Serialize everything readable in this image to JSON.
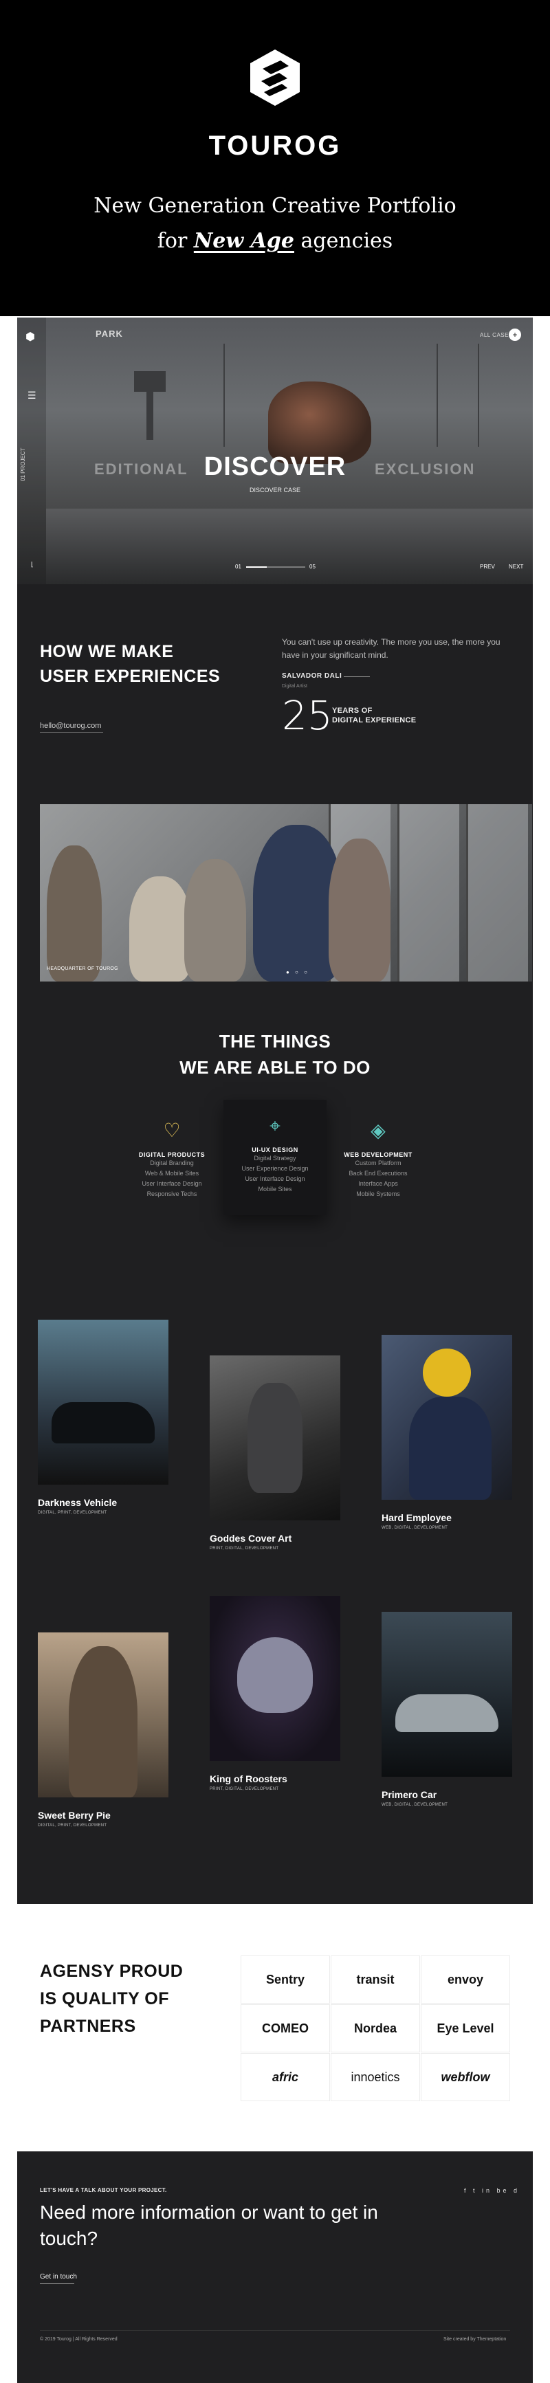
{
  "hero": {
    "brand": "TOUROG",
    "tagline_line1": "New Generation Creative Portfolio",
    "tagline_pre": "for ",
    "tagline_em": "New Age",
    "tagline_post": " agencies"
  },
  "mockup_header": {
    "logo_label": "PARK",
    "all_cases": "ALL CASES",
    "plus": "+",
    "side_label": "01 PROJECT",
    "slide_left": "EDITIONAL",
    "slide_title": "DISCOVER",
    "slide_subtitle": "DISCOVER CASE",
    "slide_right": "EXCLUSION",
    "pager_start": "01",
    "pager_end": "05",
    "pager_progress": 0.35,
    "prev": "PREV",
    "next": "NEXT"
  },
  "intro": {
    "heading_line1": "HOW WE MAKE",
    "heading_line2": "USER EXPERIENCES",
    "email": "hello@tourog.com",
    "quote": "You can't use up creativity. The more you use, the more you have in your significant mind.",
    "author": "SALVADOR DALI",
    "author_role": "Digital Artist",
    "years": "25",
    "years_label_line1": "YEARS OF",
    "years_label_line2": "DIGITAL EXPERIENCE"
  },
  "team": {
    "caption": "HEADQUARTER OF TOUROG"
  },
  "services": {
    "title_line1": "THE THINGS",
    "title_line2": "WE ARE ABLE TO DO",
    "items": [
      {
        "icon": "lightbulb-icon",
        "name": "DIGITAL PRODUCTS",
        "lines": [
          "Digital Branding",
          "Web & Mobile Sites",
          "User Interface Design",
          "Responsive Techs"
        ]
      },
      {
        "icon": "vector-pen-icon",
        "name": "UI-UX DESIGN",
        "lines": [
          "Digital Strategy",
          "User Experience Design",
          "User Interface Design",
          "Mobile Sites"
        ]
      },
      {
        "icon": "layers-icon",
        "name": "WEB DEVELOPMENT",
        "lines": [
          "Custom Platform",
          "Back End Executions",
          "Interface Apps",
          "Mobile Systems"
        ]
      }
    ]
  },
  "portfolio": [
    {
      "title": "Darkness Vehicle",
      "meta": "DIGITAL, PRINT, DEVELOPMENT"
    },
    {
      "title": "Goddes Cover Art",
      "meta": "PRINT, DIGITAL, DEVELOPMENT"
    },
    {
      "title": "Hard Employee",
      "meta": "WEB, DIGITAL, DEVELOPMENT"
    },
    {
      "title": "Sweet Berry Pie",
      "meta": "DIGITAL, PRINT, DEVELOPMENT"
    },
    {
      "title": "King of Roosters",
      "meta": "PRINT, DIGITAL, DEVELOPMENT"
    },
    {
      "title": "Primero Car",
      "meta": "WEB, DIGITAL, DEVELOPMENT"
    }
  ],
  "partners": {
    "heading_line1": "AGENSY PROUD",
    "heading_line2": "IS QUALITY OF",
    "heading_line3": "PARTNERS",
    "logos": [
      "Sentry",
      "transit",
      "envoy",
      "COMEO",
      "Nordea",
      "Eye Level",
      "afric",
      "innoetics",
      "webflow"
    ]
  },
  "footer": {
    "kicker": "LET'S HAVE A TALK ABOUT YOUR PROJECT.",
    "heading": "Need more information or want to get in touch?",
    "cta": "Get in touch",
    "social": "f t in be d",
    "copyright": "© 2019 Tourog | All Rights Reserved",
    "credit": "Site created by Themeptation"
  },
  "colors": {
    "hero_bg": "#000000",
    "mock_bg": "#1f1f21",
    "accent_yellow": "#e8c65a",
    "accent_teal": "#5fc9c1"
  }
}
